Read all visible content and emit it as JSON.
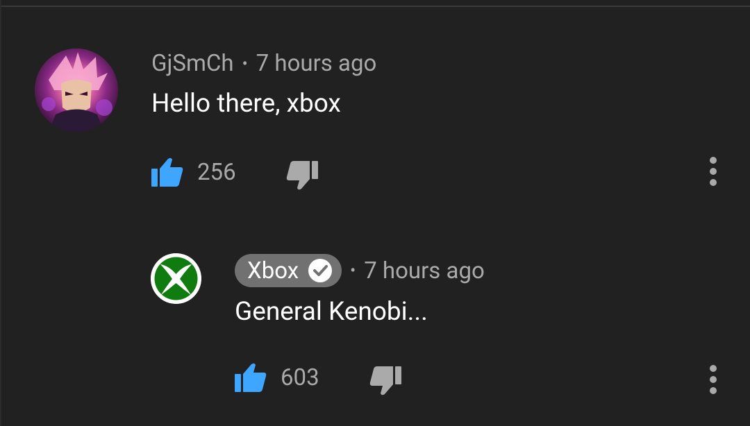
{
  "comments": [
    {
      "author": "GjSmCh",
      "separator": "•",
      "time": "7 hours ago",
      "text": "Hello there, xbox",
      "likes": "256",
      "avatar": "anime-character-avatar",
      "verified": false
    },
    {
      "author": "Xbox",
      "separator": "•",
      "time": "7 hours ago",
      "text": "General Kenobi...",
      "likes": "603",
      "avatar": "xbox-logo-avatar",
      "verified": true
    }
  ],
  "colors": {
    "background": "#212121",
    "like_blue": "#3ea6ff",
    "muted_text": "#aaaaaa",
    "badge_bg": "#717171",
    "xbox_green": "#107c10"
  },
  "icons": [
    "like-icon",
    "dislike-icon",
    "more-vert-icon",
    "verified-check-icon"
  ]
}
